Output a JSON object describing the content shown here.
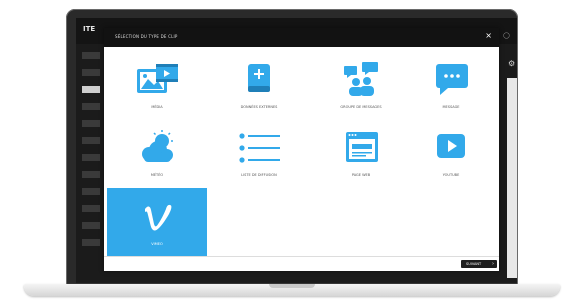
{
  "app": {
    "logo": "ITE"
  },
  "modal": {
    "title": "SÉLECTION DU TYPE DE CLIP",
    "close": "×"
  },
  "tiles": [
    {
      "label": "MÉDIA",
      "icon": "media-icon",
      "selected": false
    },
    {
      "label": "DONNÉES EXTERNES",
      "icon": "external-data-icon",
      "selected": false
    },
    {
      "label": "GROUPE DE MESSAGES",
      "icon": "message-group-icon",
      "selected": false
    },
    {
      "label": "MESSAGE",
      "icon": "message-icon",
      "selected": false
    },
    {
      "label": "MÉTÉO",
      "icon": "weather-icon",
      "selected": false
    },
    {
      "label": "LISTE DE DIFFUSION",
      "icon": "playlist-icon",
      "selected": false
    },
    {
      "label": "PAGE WEB",
      "icon": "web-page-icon",
      "selected": false
    },
    {
      "label": "YOUTUBE",
      "icon": "youtube-icon",
      "selected": false
    },
    {
      "label": "VIMEO",
      "icon": "vimeo-icon",
      "selected": true
    }
  ],
  "footer": {
    "next_label": "SUIVANT",
    "next_arrow": "›"
  },
  "colors": {
    "accent": "#32a9ea",
    "header": "#121212",
    "laptop_bezel": "#2a2a2a"
  }
}
